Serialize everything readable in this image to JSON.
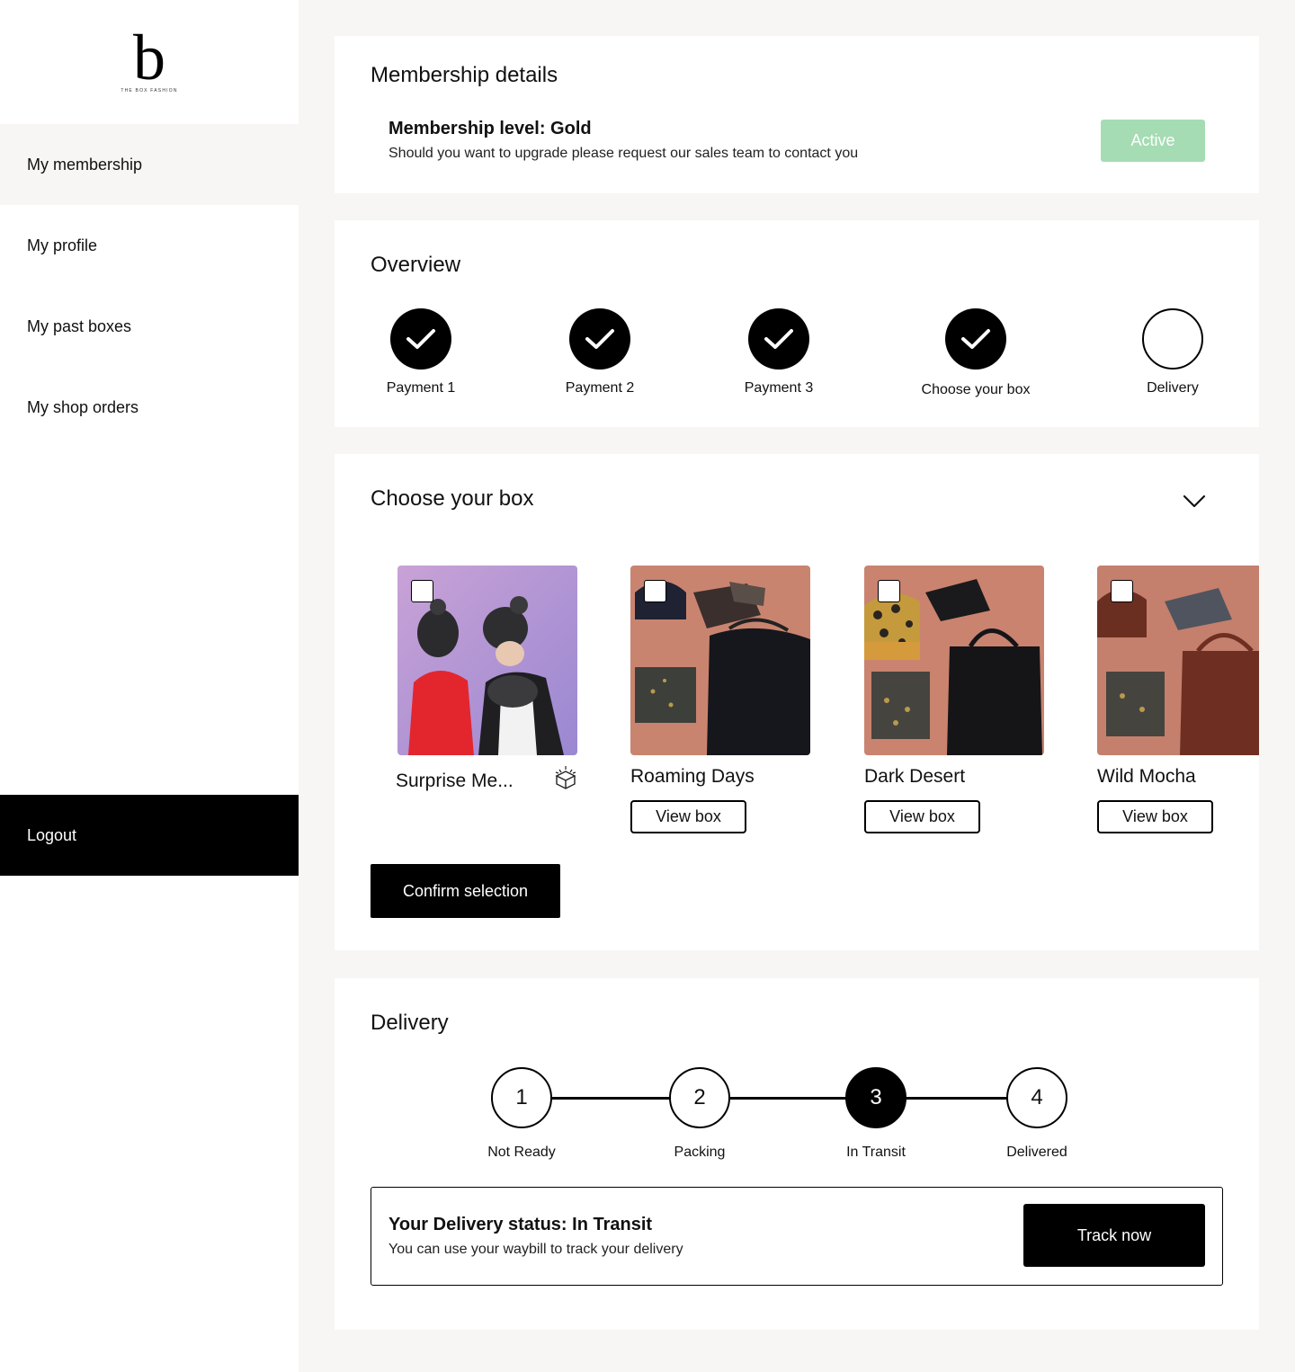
{
  "brand": {
    "letter": "b",
    "name": "THE BOX FASHION"
  },
  "nav": {
    "items": [
      {
        "label": "My membership"
      },
      {
        "label": "My profile"
      },
      {
        "label": "My past boxes"
      },
      {
        "label": "My shop orders"
      }
    ],
    "logout": "Logout"
  },
  "membership": {
    "title": "Membership details",
    "level": "Membership level: Gold",
    "subtitle": "Should you want to upgrade please request our sales team to contact you",
    "status": "Active",
    "status_color": "#a5dcb3"
  },
  "overview": {
    "title": "Overview",
    "steps": [
      {
        "label": "Payment 1",
        "done": true
      },
      {
        "label": "Payment 2",
        "done": true
      },
      {
        "label": "Payment 3",
        "done": true
      },
      {
        "label": "Choose your box",
        "done": true
      },
      {
        "label": "Delivery",
        "done": false
      }
    ]
  },
  "choose_box": {
    "title": "Choose your box",
    "toggle_icon": "chevron-down-icon",
    "boxes": [
      {
        "name": "Surprise Me...",
        "icon": "open-box-icon"
      },
      {
        "name": "Roaming Days",
        "button": "View box"
      },
      {
        "name": "Dark Desert",
        "button": "View box"
      },
      {
        "name": "Wild Mocha",
        "button": "View box"
      }
    ],
    "confirm": "Confirm selection"
  },
  "delivery": {
    "title": "Delivery",
    "steps": [
      {
        "number": "1",
        "label": "Not Ready"
      },
      {
        "number": "2",
        "label": "Packing"
      },
      {
        "number": "3",
        "label": "In Transit",
        "current": true
      },
      {
        "number": "4",
        "label": "Delivered"
      }
    ],
    "status_title": "Your Delivery status: In Transit",
    "status_sub": "You can use your waybill to track your delivery",
    "track": "Track now"
  }
}
